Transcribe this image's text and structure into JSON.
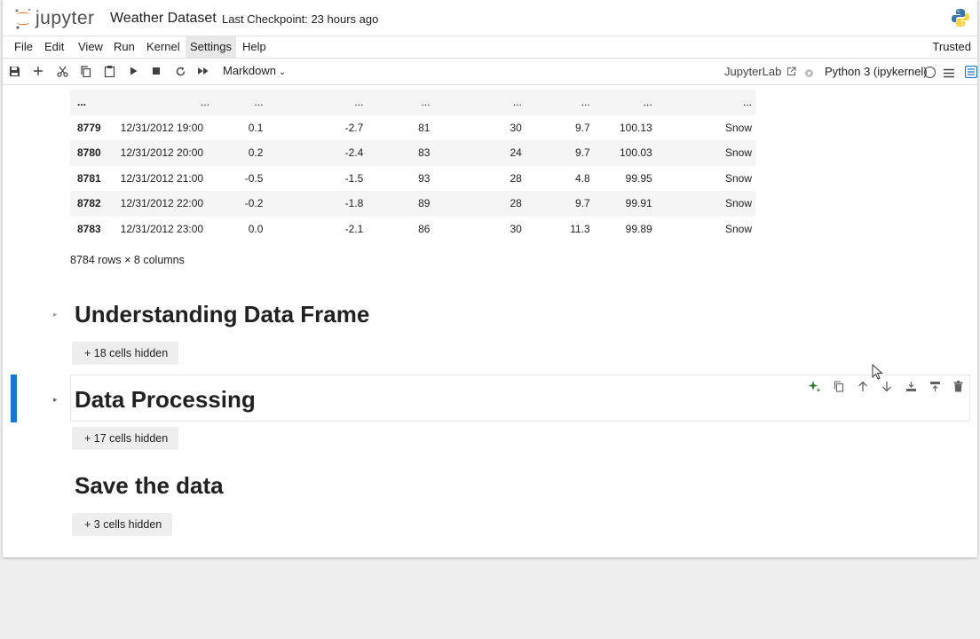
{
  "topbar": {
    "logo_text": "jupyter",
    "notebook_title": "Weather Dataset",
    "checkpoint": "Last Checkpoint: 23 hours ago"
  },
  "menu": {
    "items": [
      "File",
      "Edit",
      "View",
      "Run",
      "Kernel",
      "Settings",
      "Help"
    ],
    "active": "Settings",
    "trusted": "Trusted"
  },
  "toolbar": {
    "cell_type": "Markdown",
    "jupyterlab_link": "JupyterLab",
    "kernel": "Python 3 (ipykernel)"
  },
  "table": {
    "rows": [
      [
        "...",
        "...",
        "...",
        "...",
        "...",
        "...",
        "...",
        "...",
        "..."
      ],
      [
        "8779",
        "12/31/2012 19:00",
        "0.1",
        "-2.7",
        "81",
        "30",
        "9.7",
        "100.13",
        "Snow"
      ],
      [
        "8780",
        "12/31/2012 20:00",
        "0.2",
        "-2.4",
        "83",
        "24",
        "9.7",
        "100.03",
        "Snow"
      ],
      [
        "8781",
        "12/31/2012 21:00",
        "-0.5",
        "-1.5",
        "93",
        "28",
        "4.8",
        "99.95",
        "Snow"
      ],
      [
        "8782",
        "12/31/2012 22:00",
        "-0.2",
        "-1.8",
        "89",
        "28",
        "9.7",
        "99.91",
        "Snow"
      ],
      [
        "8783",
        "12/31/2012 23:00",
        "0.0",
        "-2.1",
        "86",
        "30",
        "11.3",
        "99.89",
        "Snow"
      ]
    ],
    "summary": "8784 rows × 8 columns"
  },
  "sections": [
    {
      "title": "Understanding Data Frame",
      "hidden": "18 cells hidden"
    },
    {
      "title": "Data Processing",
      "hidden": "17 cells hidden"
    },
    {
      "title": "Save the data",
      "hidden": "3 cells hidden"
    }
  ],
  "colors": {
    "accent": "#1976d2",
    "logo_orange": "#f37726",
    "ai_green": "#2e7d32"
  }
}
